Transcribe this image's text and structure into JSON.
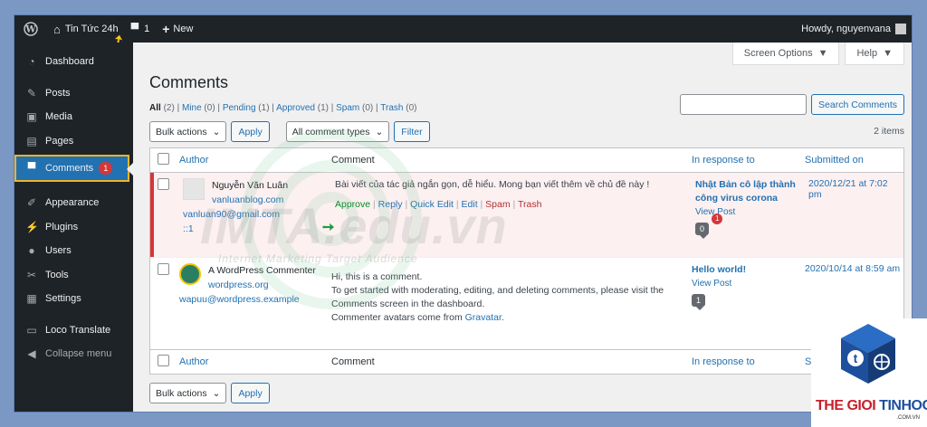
{
  "adminbar": {
    "site_name": "Tin Tức 24h",
    "comments_count": "1",
    "new_label": "New",
    "howdy": "Howdy, nguyenvana"
  },
  "sidebar": {
    "items": [
      {
        "label": "Dashboard",
        "icon": "dashboard-icon"
      },
      {
        "label": "Posts",
        "icon": "pin-icon"
      },
      {
        "label": "Media",
        "icon": "media-icon"
      },
      {
        "label": "Pages",
        "icon": "pages-icon"
      },
      {
        "label": "Comments",
        "icon": "comment-icon",
        "badge": "1"
      },
      {
        "label": "Appearance",
        "icon": "brush-icon"
      },
      {
        "label": "Plugins",
        "icon": "plug-icon"
      },
      {
        "label": "Users",
        "icon": "user-icon"
      },
      {
        "label": "Tools",
        "icon": "wrench-icon"
      },
      {
        "label": "Settings",
        "icon": "settings-icon"
      },
      {
        "label": "Loco Translate",
        "icon": "translate-icon"
      }
    ],
    "collapse_label": "Collapse menu"
  },
  "screen_options": "Screen Options",
  "help": "Help",
  "title": "Comments",
  "filters": {
    "all": "All",
    "all_count": "(2)",
    "mine": "Mine",
    "mine_count": "(0)",
    "pending": "Pending",
    "pending_count": "(1)",
    "approved": "Approved",
    "approved_count": "(1)",
    "spam": "Spam",
    "spam_count": "(0)",
    "trash": "Trash",
    "trash_count": "(0)"
  },
  "search": {
    "button": "Search Comments",
    "placeholder": ""
  },
  "bulk_actions": "Bulk actions",
  "apply": "Apply",
  "comment_types": "All comment types",
  "filter_btn": "Filter",
  "items_count": "2 items",
  "columns": {
    "author": "Author",
    "comment": "Comment",
    "response": "In response to",
    "submitted": "Submitted on"
  },
  "comments": [
    {
      "author": "Nguyễn Văn Luân",
      "site": "vanluanblog.com",
      "email": "vanluan90@gmail.com",
      "ip": "::1",
      "text": "Bài viết của tác giả ngắn gọn, dễ hiểu. Mong bạn viết thêm về chủ đề này !",
      "actions": {
        "approve": "Approve",
        "reply": "Reply",
        "quick_edit": "Quick Edit",
        "edit": "Edit",
        "spam": "Spam",
        "trash": "Trash"
      },
      "response_title": "Nhật Bản cô lập thành công virus corona",
      "view_post": "View Post",
      "approved_count": "0",
      "pending_count": "1",
      "submitted": "2020/12/21 at 7:02 pm"
    },
    {
      "author": "A WordPress Commenter",
      "site": "wordpress.org",
      "email": "wapuu@wordpress.example",
      "text_1": "Hi, this is a comment.",
      "text_2": "To get started with moderating, editing, and deleting comments, please visit the Comments screen in the dashboard.",
      "text_3": "Commenter avatars come from",
      "gravatar": "Gravatar",
      "text_3_end": ".",
      "response_title": "Hello world!",
      "view_post": "View Post",
      "approved_count": "1",
      "submitted": "2020/10/14 at 8:59 am"
    }
  ],
  "watermark": {
    "main": "IMTA.edu.vn",
    "sub": "Internet Marketing Target Audience"
  },
  "logo": {
    "brand_red": "THE GIOI ",
    "brand_blue": "TINHOC",
    "domain": ".COM.VN"
  },
  "colors": {
    "accent": "#2271b1",
    "admin_bar": "#1d2327",
    "pending_red": "#d63638",
    "approve_green": "#008a20"
  }
}
